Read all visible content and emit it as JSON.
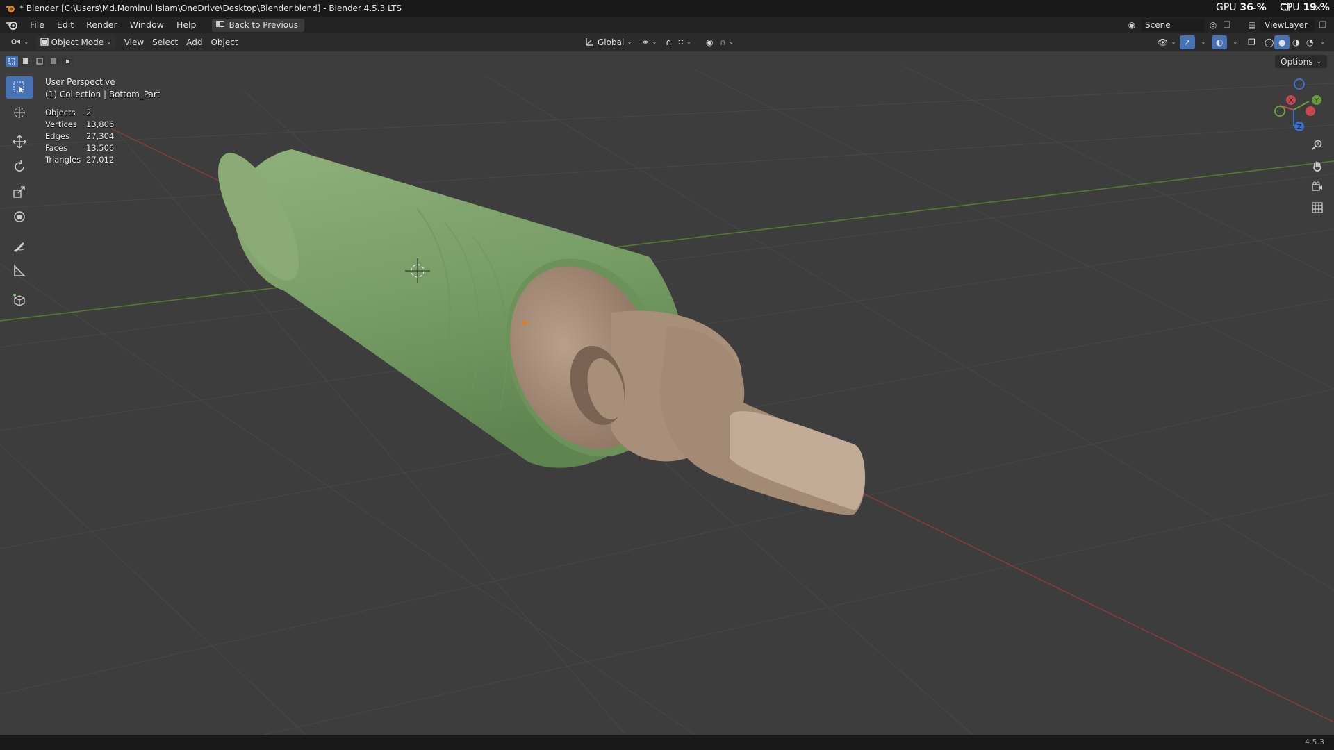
{
  "window": {
    "title": "* Blender [C:\\Users\\Md.Mominul Islam\\OneDrive\\Desktop\\Blender.blend] - Blender 4.5.3 LTS",
    "gpu_label": "GPU",
    "gpu_value": "36 %",
    "cpu_label": "CPU",
    "cpu_value": "19 %"
  },
  "menubar": {
    "items": [
      "File",
      "Edit",
      "Render",
      "Window",
      "Help"
    ],
    "back_button": "Back to Previous",
    "scene": "Scene",
    "view_layer": "ViewLayer"
  },
  "viewport_header": {
    "mode": "Object Mode",
    "menus": [
      "View",
      "Select",
      "Add",
      "Object"
    ],
    "orientation": "Global"
  },
  "options_label": "Options",
  "viewport": {
    "perspective": "User Perspective",
    "collection": "(1) Collection | Bottom_Part"
  },
  "stats": [
    {
      "label": "Objects",
      "value": "2"
    },
    {
      "label": "Vertices",
      "value": "13,806"
    },
    {
      "label": "Edges",
      "value": "27,304"
    },
    {
      "label": "Faces",
      "value": "13,506"
    },
    {
      "label": "Triangles",
      "value": "27,012"
    }
  ],
  "gizmo": {
    "x": "X",
    "y": "Y",
    "z": "Z"
  },
  "status": {
    "version": "4.5.3"
  },
  "colors": {
    "accent": "#4772b3",
    "green_part": "#7a9e68",
    "tan_part": "#a48a74",
    "axis_x": "#c8464f",
    "axis_y": "#6b9a3b",
    "axis_z": "#3b6fcc"
  },
  "icons": [
    "blender-logo-icon",
    "select-box-icon",
    "cursor-icon",
    "move-icon",
    "rotate-icon",
    "scale-icon",
    "transform-icon",
    "annotate-icon",
    "measure-icon",
    "add-cube-icon",
    "zoom-icon",
    "hand-icon",
    "camera-icon",
    "grid-icon"
  ]
}
